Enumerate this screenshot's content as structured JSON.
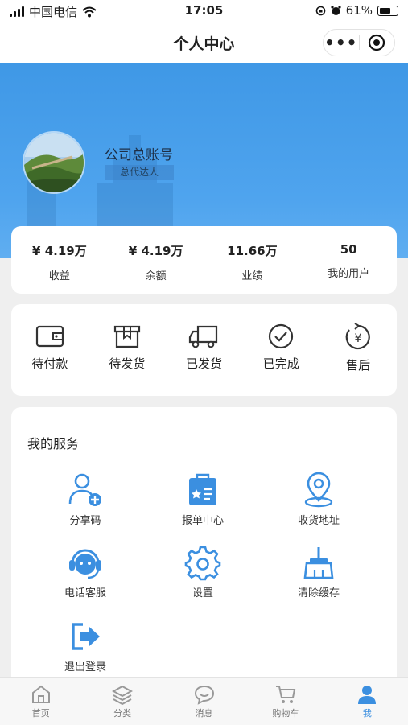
{
  "status_bar": {
    "carrier": "中国电信",
    "time": "17:05",
    "battery": "61%"
  },
  "nav": {
    "title": "个人中心",
    "more": "•••"
  },
  "profile": {
    "name": "公司总账号",
    "role": "总代达人"
  },
  "stats": [
    {
      "value": "¥ 4.19万",
      "label": "收益"
    },
    {
      "value": "¥ 4.19万",
      "label": "余额"
    },
    {
      "value": "11.66万",
      "label": "业绩"
    },
    {
      "value": "50",
      "label": "我的用户"
    }
  ],
  "orders": [
    {
      "label": "待付款",
      "icon": "wallet-icon"
    },
    {
      "label": "待发货",
      "icon": "box-icon"
    },
    {
      "label": "已发货",
      "icon": "truck-icon"
    },
    {
      "label": "已完成",
      "icon": "check-circle-icon"
    },
    {
      "label": "售后",
      "icon": "refund-icon"
    }
  ],
  "services": {
    "title": "我的服务",
    "items": [
      {
        "label": "分享码",
        "icon": "add-user-icon"
      },
      {
        "label": "报单中心",
        "icon": "order-bag-icon"
      },
      {
        "label": "收货地址",
        "icon": "location-icon"
      },
      {
        "label": "电话客服",
        "icon": "headset-icon"
      },
      {
        "label": "设置",
        "icon": "gear-icon"
      },
      {
        "label": "清除缓存",
        "icon": "broom-icon"
      },
      {
        "label": "退出登录",
        "icon": "logout-icon"
      }
    ]
  },
  "tabs": [
    {
      "label": "首页",
      "icon": "home-icon"
    },
    {
      "label": "分类",
      "icon": "layers-icon"
    },
    {
      "label": "消息",
      "icon": "message-icon"
    },
    {
      "label": "购物车",
      "icon": "cart-icon"
    },
    {
      "label": "我",
      "icon": "user-icon",
      "active": true
    }
  ],
  "colors": {
    "accent": "#3b8fe0",
    "hero": "#4aa0ec"
  }
}
